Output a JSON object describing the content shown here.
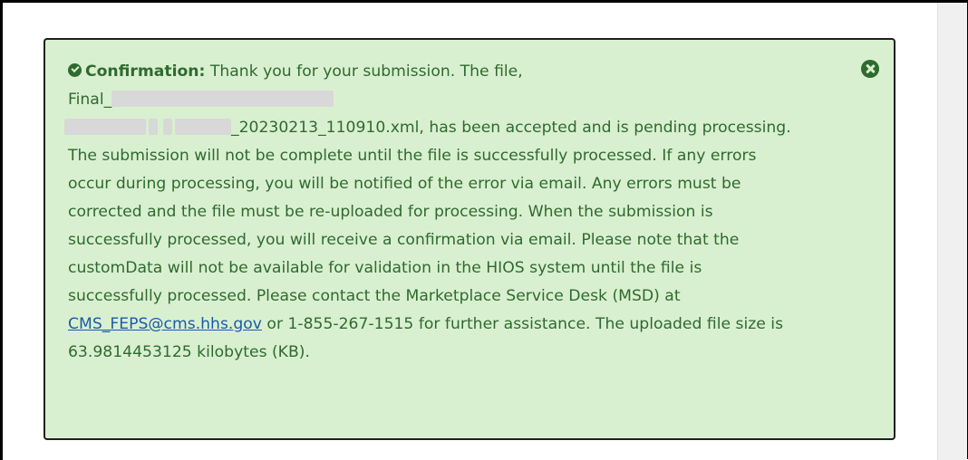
{
  "alert": {
    "label": "Confirmation:",
    "intro": "Thank you for your submission. The file,",
    "file_prefix": "Final_",
    "file_suffix": "_20230213_110910.xml, has been accepted and is",
    "body_1": "pending processing. The submission will not be complete until the file is successfully processed. If any errors occur during processing, you will be notified of the error via email. Any errors must be corrected and the file must be re-uploaded for processing. When the submission is successfully processed, you will receive a confirmation via email. Please note that the customData will not be available for validation in the HIOS system until the file is successfully processed. Please contact the Marketplace Service Desk (MSD) at ",
    "email_link": "CMS_FEPS@cms.hhs.gov",
    "body_2": " or 1-855-267-1515 for further assistance. The uploaded file size is 63.9814453125 kilobytes (KB).",
    "colors": {
      "background": "#d9f0d0",
      "text": "#2f6a2f",
      "link": "#1b5ba8",
      "border": "#1f1f1f"
    },
    "icons": {
      "status": "check-circle-icon",
      "close": "close-circle-icon"
    }
  }
}
